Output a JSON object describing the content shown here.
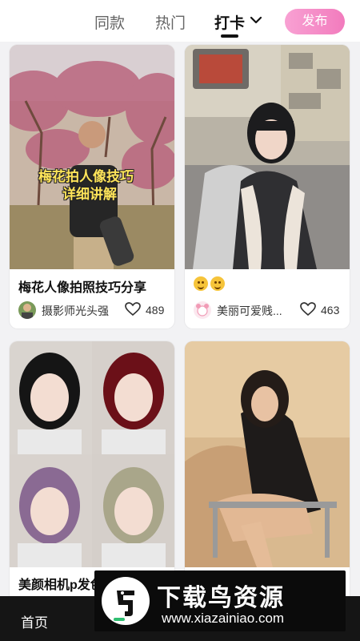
{
  "header": {
    "tabs": [
      {
        "label": "同款"
      },
      {
        "label": "热门"
      },
      {
        "label": "打卡"
      }
    ],
    "active_tab": "打卡",
    "publish_label": "发布",
    "accent": "#f27bbd"
  },
  "feed": [
    {
      "title": "梅花人像拍照技巧分享",
      "overlay": [
        "梅花拍人像技巧",
        "详细讲解"
      ],
      "author": "摄影师光头强",
      "likes": "489"
    },
    {
      "title": "",
      "title_icons": [
        "smile-emoji",
        "smile-emoji"
      ],
      "author": "美丽可爱贱...",
      "likes": "463"
    },
    {
      "title": "美颜相机p发色技巧分享"
    },
    {
      "title": ""
    }
  ],
  "bottom_nav": {
    "home_label": "首页"
  },
  "watermark": {
    "text": "下载鸟资源",
    "url": "www.xiazainiao.com"
  }
}
